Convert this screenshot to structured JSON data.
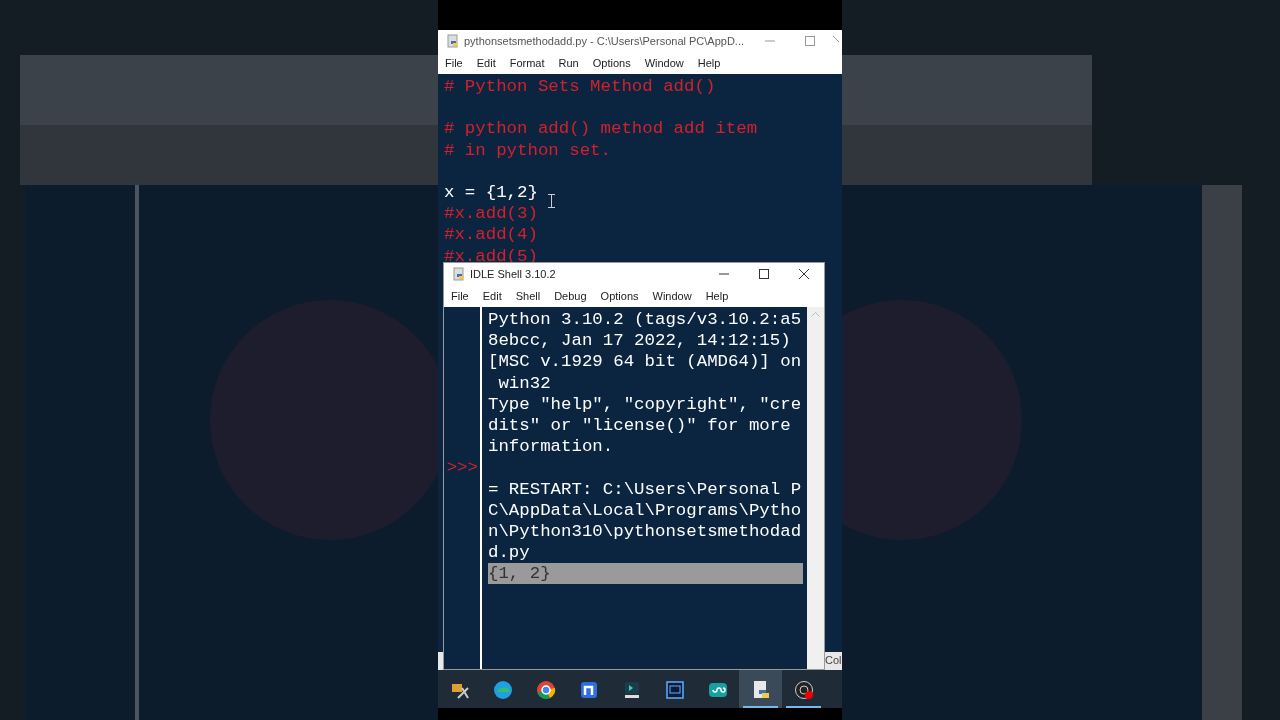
{
  "editor_window": {
    "title": "pythonsetsmethodadd.py - C:\\Users\\Personal PC\\AppD...",
    "menu": [
      "File",
      "Edit",
      "Format",
      "Run",
      "Options",
      "Window",
      "Help"
    ],
    "code_lines": [
      {
        "kind": "comment",
        "text": "# Python Sets Method add()"
      },
      {
        "kind": "blank"
      },
      {
        "kind": "comment",
        "text": "# python add() method add item"
      },
      {
        "kind": "comment",
        "text": "# in python set."
      },
      {
        "kind": "blank"
      },
      {
        "kind": "code",
        "text": "x = {1,2}"
      },
      {
        "kind": "comment",
        "text": "#x.add(3)"
      },
      {
        "kind": "comment",
        "text": "#x.add(4)"
      },
      {
        "kind": "comment",
        "text": "#x.add(5)"
      }
    ],
    "status_text": "Col"
  },
  "shell_window": {
    "title": "IDLE Shell 3.10.2",
    "menu": [
      "File",
      "Edit",
      "Shell",
      "Debug",
      "Options",
      "Window",
      "Help"
    ],
    "rows": [
      {
        "kind": "output",
        "text": "Python 3.10.2 (tags/v3.10.2:a5"
      },
      {
        "kind": "output",
        "text": "8ebcc, Jan 17 2022, 14:12:15)"
      },
      {
        "kind": "output",
        "text": "[MSC v.1929 64 bit (AMD64)] on"
      },
      {
        "kind": "output",
        "text": " win32"
      },
      {
        "kind": "output",
        "text": "Type \"help\", \"copyright\", \"cre"
      },
      {
        "kind": "output",
        "text": "dits\" or \"license()\" for more"
      },
      {
        "kind": "output",
        "text": "information."
      },
      {
        "kind": "prompt",
        "prompt": ">>>"
      },
      {
        "kind": "output",
        "text": "= RESTART: C:\\Users\\Personal P"
      },
      {
        "kind": "output",
        "text": "C\\AppData\\Local\\Programs\\Pytho"
      },
      {
        "kind": "output",
        "text": "n\\Python310\\pythonsetsmethodad"
      },
      {
        "kind": "output",
        "text": "d.py"
      },
      {
        "kind": "highlight",
        "text": "{1, 2}"
      }
    ]
  },
  "taskbar": {
    "apps": [
      {
        "kind": "tools",
        "selected": false,
        "open": false
      },
      {
        "kind": "edge",
        "selected": false,
        "open": false
      },
      {
        "kind": "chrome",
        "selected": false,
        "open": false
      },
      {
        "kind": "notes",
        "selected": false,
        "open": false
      },
      {
        "kind": "installer",
        "selected": false,
        "open": false
      },
      {
        "kind": "photoshop",
        "selected": false,
        "open": false
      },
      {
        "kind": "arduino",
        "selected": false,
        "open": false
      },
      {
        "kind": "python",
        "selected": true,
        "open": true
      },
      {
        "kind": "recorder",
        "selected": false,
        "open": true
      }
    ]
  }
}
